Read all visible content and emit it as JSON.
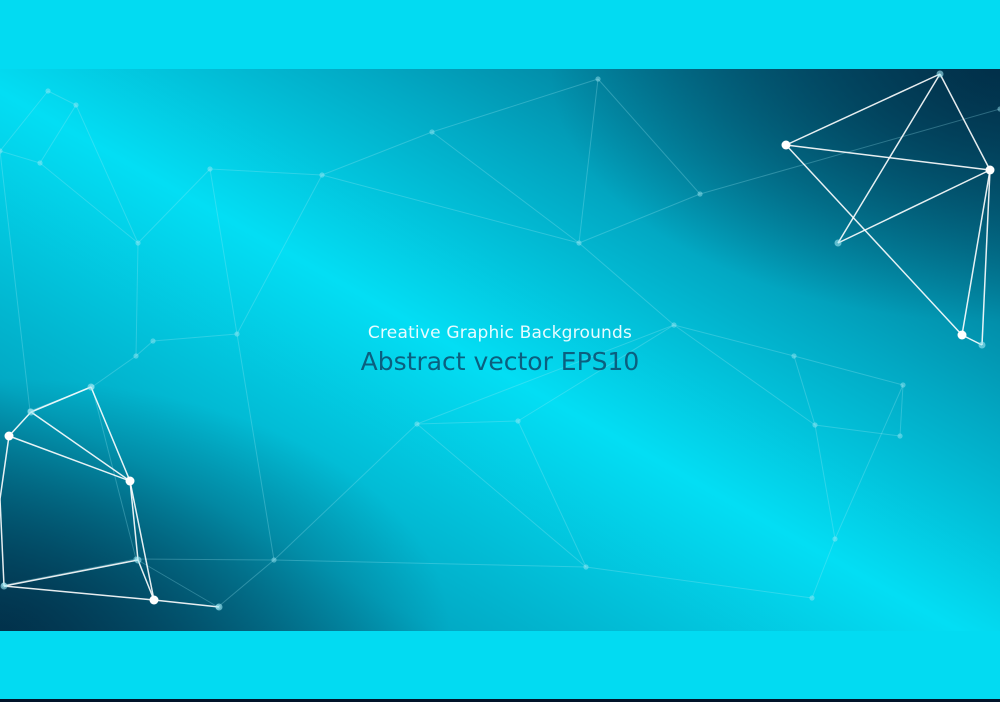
{
  "headline": {
    "line1": "Creative Graphic Backgrounds",
    "line2": "Abstract vector EPS10"
  },
  "colors": {
    "band": "#02dbf2",
    "strip": "#01142a",
    "gradient_dark": "#034f6c",
    "gradient_mid": "#02a9c4",
    "gradient_light": "#03def4",
    "line1_text": "#e7fbff",
    "line2_text": "#0b5f7f",
    "mesh_faint": "#9fe8f4",
    "mesh_bright": "#ffffff"
  }
}
